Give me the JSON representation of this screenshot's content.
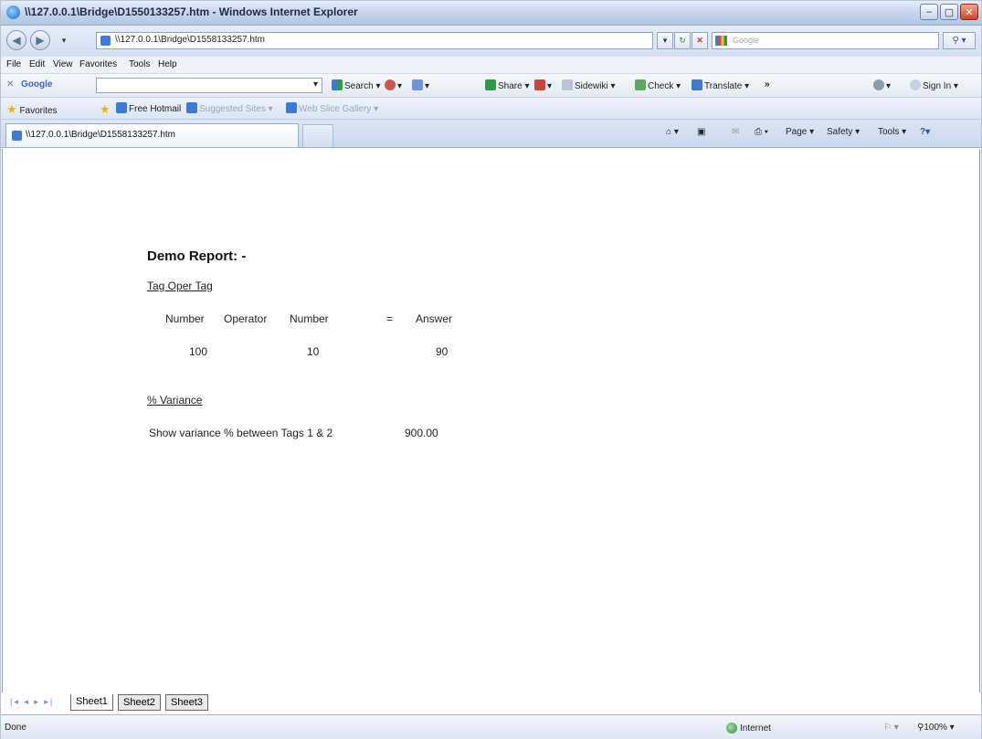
{
  "window": {
    "title": "\\\\127.0.0.1\\Bridge\\D1550133257.htm - Windows Internet Explorer",
    "min_glyph": "–",
    "max_glyph": "▢",
    "close_glyph": "✕"
  },
  "address": {
    "url": "\\\\127.0.0.1\\Bridge\\D1558133257.htm",
    "search_placeholder": "Google",
    "search_button": "⚲ ▾"
  },
  "menu": [
    "File",
    "Edit",
    "View",
    "Favorites",
    "Tools",
    "Help"
  ],
  "google_toolbar": {
    "close": "✕",
    "logo": "Google",
    "search": "Search ▾",
    "share": "Share ▾",
    "sidewiki": "Sidewiki ▾",
    "check": "Check ▾",
    "translate": "Translate ▾",
    "more": "»",
    "sign_in": "Sign In ▾"
  },
  "favorites": {
    "label": "Favorites",
    "items": [
      "Free Hotmail",
      "Suggested Sites ▾",
      "Web Slice Gallery ▾"
    ]
  },
  "tab": {
    "label": "\\\\127.0.0.1\\Bridge\\D1558133257.htm"
  },
  "command_bar": {
    "page": "Page ▾",
    "safety": "Safety ▾",
    "tools": "Tools ▾",
    "help": "?▾"
  },
  "report": {
    "title": "Demo Report: -",
    "section1": "Tag Oper Tag",
    "headers": [
      "Number",
      "Operator",
      "Number",
      "=",
      "Answer"
    ],
    "row": {
      "number1": "100",
      "number2": "10",
      "answer": "90"
    },
    "section2": "% Variance",
    "variance_label": "Show variance % between Tags 1 & 2",
    "variance_value": "900.00"
  },
  "sheets": {
    "nav": "|◂ ◂ ▸ ▸|",
    "tabs": [
      "Sheet1",
      "Sheet2",
      "Sheet3"
    ]
  },
  "status": {
    "left": "Done",
    "zone": "Internet",
    "zoom": "100%"
  },
  "colors": {
    "accent": "#3d7ad6",
    "chrome": "#c4d3ea"
  }
}
